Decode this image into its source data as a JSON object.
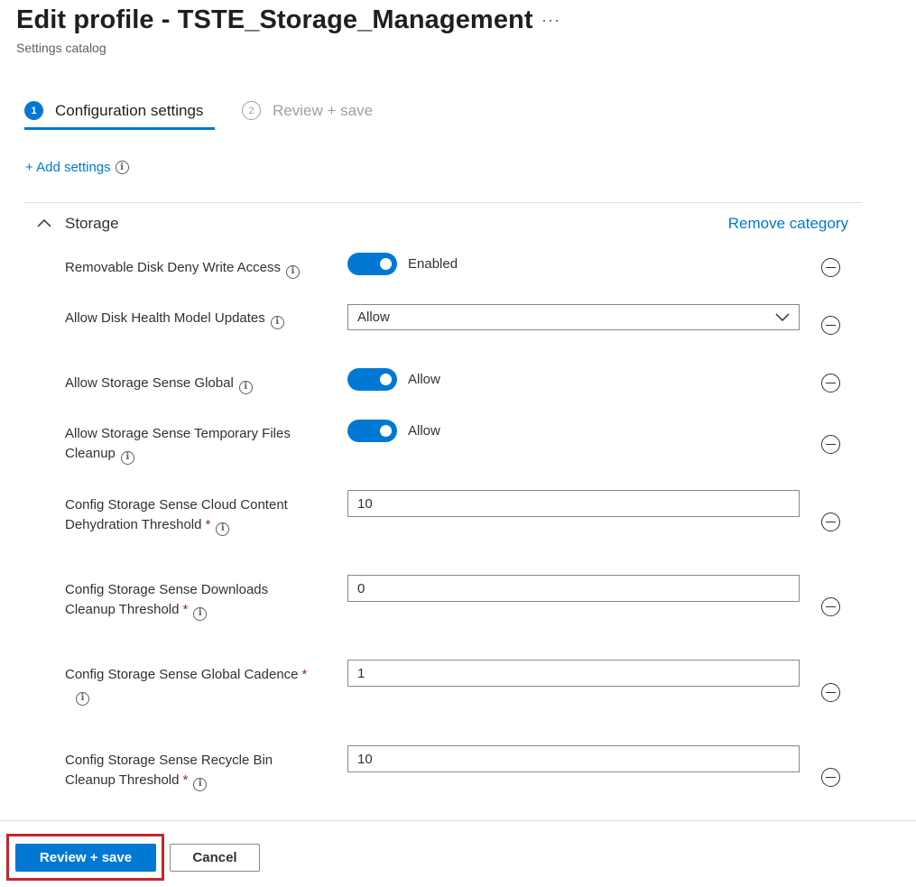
{
  "header": {
    "title": "Edit profile - TSTE_Storage_Management",
    "more_label": "···",
    "subtitle": "Settings catalog"
  },
  "wizard": {
    "steps": [
      {
        "number": "1",
        "label": "Configuration settings",
        "active": true
      },
      {
        "number": "2",
        "label": "Review + save",
        "active": false
      }
    ]
  },
  "add_settings": {
    "label": "+ Add settings",
    "info": "i"
  },
  "category": {
    "title": "Storage",
    "remove_label": "Remove category"
  },
  "settings": [
    {
      "label": "Removable Disk Deny Write Access",
      "required": false,
      "control": "toggle",
      "value": "Enabled",
      "on": true
    },
    {
      "label": "Allow Disk Health Model Updates",
      "required": false,
      "control": "dropdown",
      "value": "Allow"
    },
    {
      "label": "Allow Storage Sense Global",
      "required": false,
      "control": "toggle",
      "value": "Allow",
      "on": true
    },
    {
      "label": "Allow Storage Sense Temporary Files Cleanup",
      "required": false,
      "control": "toggle",
      "value": "Allow",
      "on": true
    },
    {
      "label": "Config Storage Sense Cloud Content Dehydration Threshold",
      "required": true,
      "control": "text",
      "value": "10"
    },
    {
      "label": "Config Storage Sense Downloads Cleanup Threshold",
      "required": true,
      "control": "text",
      "value": "0"
    },
    {
      "label": "Config Storage Sense Global Cadence",
      "required": true,
      "control": "text",
      "value": "1"
    },
    {
      "label": "Config Storage Sense Recycle Bin Cleanup Threshold",
      "required": true,
      "control": "text",
      "value": "10"
    }
  ],
  "required_marker": "*",
  "info_glyph": "i",
  "footer": {
    "primary_label": "Review + save",
    "secondary_label": "Cancel"
  },
  "colors": {
    "accent": "#0078d4",
    "required": "#a4262c",
    "highlight_border": "#c4262e"
  }
}
